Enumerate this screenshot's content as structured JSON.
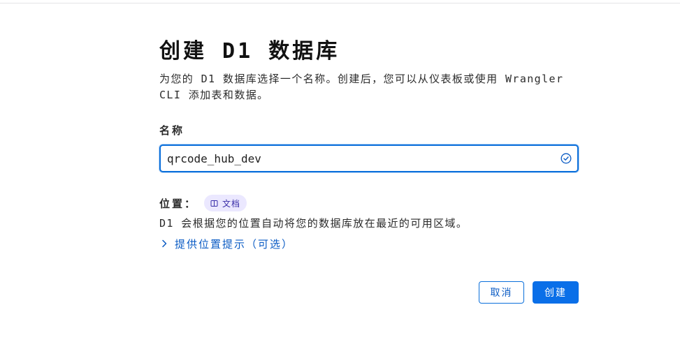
{
  "page": {
    "title": "创建 D1 数据库",
    "description": "为您的 D1 数据库选择一个名称。创建后，您可以从仪表板或使用 Wrangler CLI 添加表和数据。"
  },
  "name_field": {
    "label": "名称",
    "value": "qrcode_hub_dev",
    "valid": true
  },
  "location": {
    "label": "位置：",
    "doc_badge": "文档",
    "description": "D1 会根据您的位置自动将您的数据库放在最近的可用区域。",
    "hint_toggle": "提供位置提示（可选）"
  },
  "actions": {
    "cancel_label": "取消",
    "create_label": "创建"
  },
  "colors": {
    "accent": "#0a6fe8",
    "badge_bg": "#ebe8ff",
    "badge_text": "#3b2fa8"
  },
  "icons": [
    "check-circle-icon",
    "book-icon",
    "chevron-right-icon"
  ]
}
